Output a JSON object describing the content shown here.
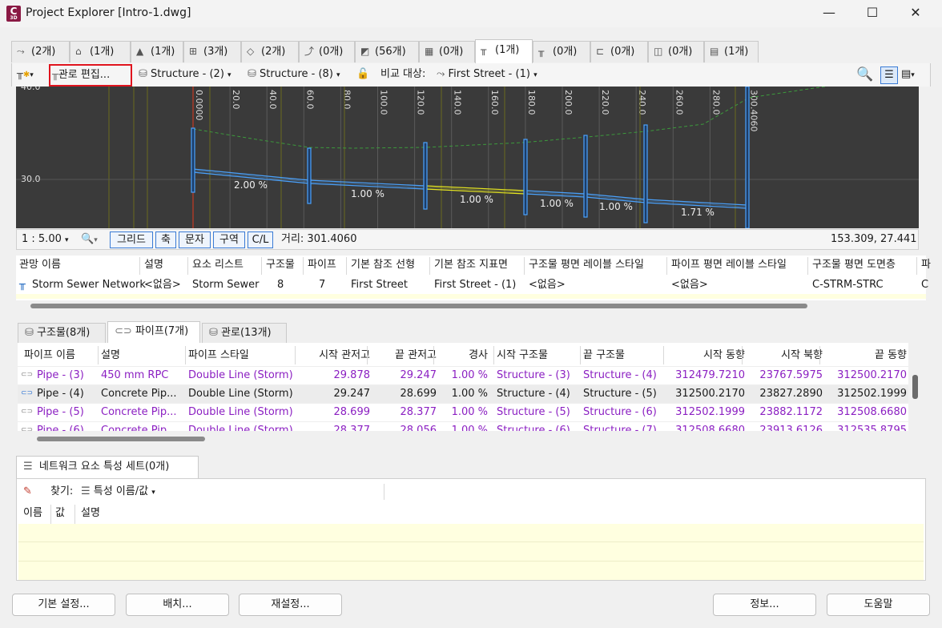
{
  "window": {
    "title": "Project Explorer [Intro-1.dwg]",
    "app_icon_text": "C",
    "app_icon_sub": "3D"
  },
  "object_tabs": [
    {
      "icon": "alignment-icon",
      "glyph": "⤳",
      "label": "(2개)"
    },
    {
      "icon": "building-icon",
      "glyph": "⌂",
      "label": "(1개)"
    },
    {
      "icon": "corridor-icon",
      "glyph": "▲",
      "label": "(1개)"
    },
    {
      "icon": "assembly-icon",
      "glyph": "⊞",
      "label": "(3개)"
    },
    {
      "icon": "surface-icon",
      "glyph": "◇",
      "label": "(2개)"
    },
    {
      "icon": "profile-icon",
      "glyph": "⤴",
      "label": "(0개)"
    },
    {
      "icon": "section-icon",
      "glyph": "◩",
      "label": "(56개)"
    },
    {
      "icon": "map-icon",
      "glyph": "▦",
      "label": "(0개)"
    },
    {
      "icon": "pipe-network-icon",
      "glyph": "╥",
      "label": "(1개)"
    },
    {
      "icon": "pressure-network-icon",
      "glyph": "╥",
      "label": "(0개)"
    },
    {
      "icon": "sample-line-icon",
      "glyph": "⊏",
      "label": "(0개)"
    },
    {
      "icon": "intersection-icon",
      "glyph": "◫",
      "label": "(0개)"
    },
    {
      "icon": "data-shortcut-icon",
      "glyph": "▤",
      "label": "(1개)"
    }
  ],
  "toolbar": {
    "edit_label": "관로 편집...",
    "structure_combo1": "Structure - (2)",
    "structure_combo2": "Structure - (8)",
    "compare_label": "비교 대상:",
    "compare_value": "First Street - (1)"
  },
  "profile_view": {
    "top_label": "40.0",
    "elev_label": "30.0",
    "station_labels": [
      "0.0000",
      "20.0",
      "40.0",
      "60.0",
      "80.0",
      "100.0",
      "120.0",
      "140.0",
      "160.0",
      "180.0",
      "200.0",
      "220.0",
      "240.0",
      "260.0",
      "280.0",
      "300.4060"
    ],
    "slope_labels": [
      "2.00 %",
      "1.00 %",
      "1.00 %",
      "1.00 %",
      "1.00 %",
      "1.71 %"
    ]
  },
  "profile_status": {
    "scale": "1 : 5.00",
    "buttons": [
      "그리드",
      "축",
      "문자",
      "구역",
      "C/L"
    ],
    "distance": "거리: 301.4060",
    "coords": "153.309, 27.441"
  },
  "network_table": {
    "headers": [
      "관망 이름",
      "설명",
      "요소 리스트",
      "구조물",
      "파이프",
      "기본 참조 선형",
      "기본 참조 지표면",
      "구조물 평면 레이블 스타일",
      "파이프 평면 레이블 스타일",
      "구조물 평면 도면층",
      "파"
    ],
    "row": [
      "Storm Sewer Network",
      "<없음>",
      "Storm Sewer",
      "8",
      "7",
      "First Street",
      "First Street - (1)",
      "<없음>",
      "<없음>",
      "C-STRM-STRC",
      "C"
    ]
  },
  "lower_tabs": [
    "구조물(8개)",
    "파이프(7개)",
    "관로(13개)"
  ],
  "pipes_table": {
    "headers": [
      "파이프 이름",
      "설명",
      "파이프 스타일",
      "시작 관저고",
      "끝 관저고",
      "경사",
      "시작 구조물",
      "끝 구조물",
      "시작 동향",
      "시작 북향",
      "끝 동향"
    ],
    "rows": [
      [
        "Pipe - (3)",
        "450 mm RPC",
        "Double Line (Storm)",
        "29.878",
        "29.247",
        "1.00 %",
        "Structure - (3)",
        "Structure - (4)",
        "312479.7210",
        "23767.5975",
        "312500.2170"
      ],
      [
        "Pipe - (4)",
        "Concrete Pip...",
        "Double Line (Storm)",
        "29.247",
        "28.699",
        "1.00 %",
        "Structure - (4)",
        "Structure - (5)",
        "312500.2170",
        "23827.2890",
        "312502.1999"
      ],
      [
        "Pipe - (5)",
        "Concrete Pip...",
        "Double Line (Storm)",
        "28.699",
        "28.377",
        "1.00 %",
        "Structure - (5)",
        "Structure - (6)",
        "312502.1999",
        "23882.1172",
        "312508.6680"
      ],
      [
        "Pipe - (6)",
        "Concrete Pip...",
        "Double Line (Storm)",
        "28.377",
        "28.056",
        "1.00 %",
        "Structure - (6)",
        "Structure - (7)",
        "312508.6680",
        "23913.6126",
        "312535.8795"
      ]
    ]
  },
  "property_sets": {
    "tab_label": "네트워크 요소 특성 세트(0개)",
    "find_label": "찾기:",
    "find_value": "특성 이름/값",
    "headers": [
      "이름",
      "값",
      "설명"
    ]
  },
  "footer_buttons": {
    "basic": "기본 설정...",
    "layout": "배치...",
    "reset": "재설정...",
    "info": "정보...",
    "help": "도움말"
  },
  "colors": {
    "accent": "#3a7bd5",
    "highlight_red": "#e0141e",
    "purple_text": "#8b1fc2",
    "profile_bg": "#3a3a3a",
    "pipe_blue": "#4aa3ff",
    "ground_green": "#3c9a3c"
  }
}
